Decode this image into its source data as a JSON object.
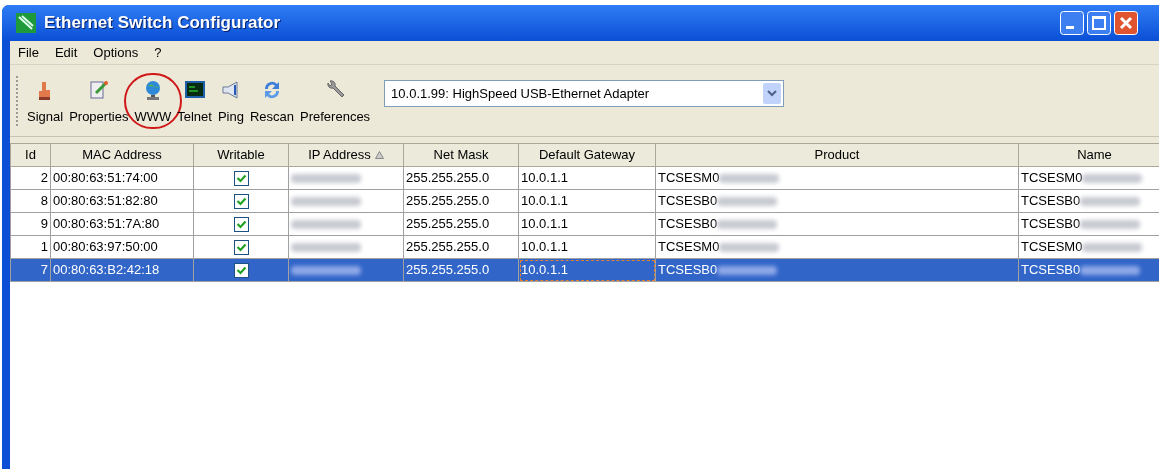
{
  "window": {
    "title": "Ethernet Switch Configurator"
  },
  "menu": [
    "File",
    "Edit",
    "Options",
    "?"
  ],
  "toolbar": [
    {
      "label": "Signal",
      "kind": "signal",
      "circled": false
    },
    {
      "label": "Properties",
      "kind": "properties",
      "circled": false
    },
    {
      "label": "WWW",
      "kind": "www",
      "circled": true
    },
    {
      "label": "Telnet",
      "kind": "telnet",
      "circled": false
    },
    {
      "label": "Ping",
      "kind": "ping",
      "circled": false
    },
    {
      "label": "Rescan",
      "kind": "rescan",
      "circled": false
    },
    {
      "label": "Preferences",
      "kind": "preferences",
      "circled": false
    }
  ],
  "adapter_select": {
    "value": "10.0.1.99: HighSpeed USB-Ethernet Adapter"
  },
  "table": {
    "columns": [
      {
        "label": "Id",
        "sorted": false
      },
      {
        "label": "MAC Address",
        "sorted": false
      },
      {
        "label": "Writable",
        "sorted": false
      },
      {
        "label": "IP Address",
        "sorted": true
      },
      {
        "label": "Net Mask",
        "sorted": false
      },
      {
        "label": "Default Gateway",
        "sorted": false
      },
      {
        "label": "Product",
        "sorted": false
      },
      {
        "label": "Name",
        "sorted": false
      }
    ],
    "rows": [
      {
        "id": "2",
        "mac": "00:80:63:51:74:00",
        "writable": true,
        "net_mask": "255.255.255.0",
        "gateway": "10.0.1.1",
        "product": "TCSESM0",
        "name": "TCSESM0",
        "redacted": true,
        "selected": false
      },
      {
        "id": "8",
        "mac": "00:80:63:51:82:80",
        "writable": true,
        "net_mask": "255.255.255.0",
        "gateway": "10.0.1.1",
        "product": "TCSESB0",
        "name": "TCSESB0",
        "redacted": true,
        "selected": false
      },
      {
        "id": "9",
        "mac": "00:80:63:51:7A:80",
        "writable": true,
        "net_mask": "255.255.255.0",
        "gateway": "10.0.1.1",
        "product": "TCSESB0",
        "name": "TCSESB0",
        "redacted": true,
        "selected": false
      },
      {
        "id": "1",
        "mac": "00:80:63:97:50:00",
        "writable": true,
        "net_mask": "255.255.255.0",
        "gateway": "10.0.1.1",
        "product": "TCSESM0",
        "name": "TCSESM0",
        "redacted": true,
        "selected": false
      },
      {
        "id": "7",
        "mac": "00:80:63:B2:42:18",
        "writable": true,
        "net_mask": "255.255.255.0",
        "gateway": "10.0.1.1",
        "product": "TCSESB0",
        "name": "TCSESB0",
        "redacted": true,
        "selected": true
      }
    ]
  }
}
